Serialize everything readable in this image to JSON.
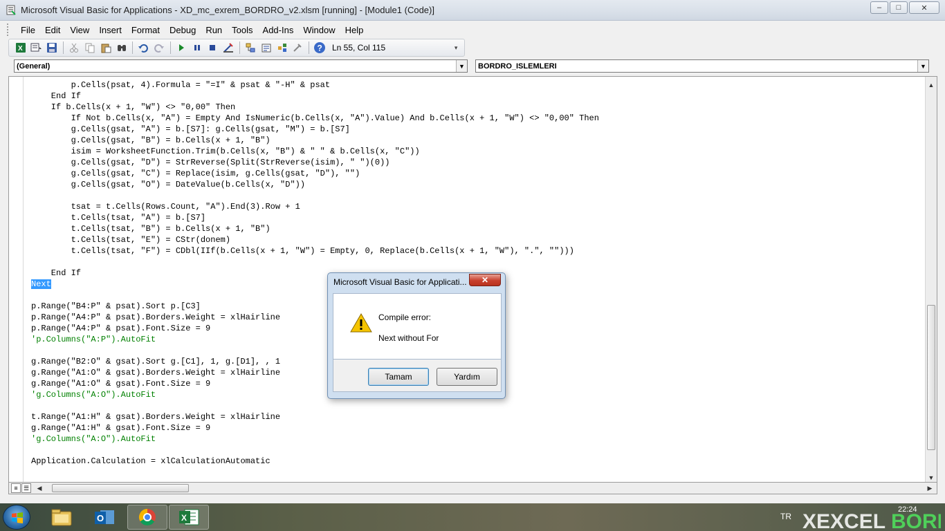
{
  "window": {
    "title": "Microsoft Visual Basic for Applications - XD_mc_exrem_BORDRO_v2.xlsm [running] - [Module1 (Code)]",
    "minimize_glyph": "–",
    "maximize_glyph": "□",
    "close_glyph": "✕"
  },
  "menu": {
    "items": [
      "File",
      "Edit",
      "View",
      "Insert",
      "Format",
      "Debug",
      "Run",
      "Tools",
      "Add-Ins",
      "Window",
      "Help"
    ]
  },
  "toolbar": {
    "icons": [
      "view-excel-icon",
      "insert-module-icon",
      "save-icon",
      "cut-icon",
      "copy-icon",
      "paste-icon",
      "find-icon",
      "undo-icon",
      "redo-icon",
      "run-icon",
      "break-icon",
      "reset-icon",
      "design-mode-icon",
      "project-explorer-icon",
      "properties-icon",
      "object-browser-icon",
      "toolbox-icon",
      "help-icon"
    ],
    "status": "Ln 55, Col 115"
  },
  "object_combo": {
    "value": "(General)"
  },
  "procedure_combo": {
    "value": "BORDRO_ISLEMLERI"
  },
  "code": {
    "lines": [
      {
        "text": "        p.Cells(psat, 4).Formula = \"=I\" & psat & \"-H\" & psat",
        "type": "code"
      },
      {
        "text": "    End If",
        "type": "code"
      },
      {
        "text": "    If b.Cells(x + 1, \"W\") <> \"0,00\" Then",
        "type": "code"
      },
      {
        "text": "        If Not b.Cells(x, \"A\") = Empty And IsNumeric(b.Cells(x, \"A\").Value) And b.Cells(x + 1, \"W\") <> \"0,00\" Then",
        "type": "code"
      },
      {
        "text": "        g.Cells(gsat, \"A\") = b.[S7]: g.Cells(gsat, \"M\") = b.[S7]",
        "type": "code"
      },
      {
        "text": "        g.Cells(gsat, \"B\") = b.Cells(x + 1, \"B\")",
        "type": "code"
      },
      {
        "text": "        isim = WorksheetFunction.Trim(b.Cells(x, \"B\") & \" \" & b.Cells(x, \"C\"))",
        "type": "code"
      },
      {
        "text": "        g.Cells(gsat, \"D\") = StrReverse(Split(StrReverse(isim), \" \")(0))",
        "type": "code"
      },
      {
        "text": "        g.Cells(gsat, \"C\") = Replace(isim, g.Cells(gsat, \"D\"), \"\")",
        "type": "code"
      },
      {
        "text": "        g.Cells(gsat, \"O\") = DateValue(b.Cells(x, \"D\"))",
        "type": "code"
      },
      {
        "text": "",
        "type": "code"
      },
      {
        "text": "        tsat = t.Cells(Rows.Count, \"A\").End(3).Row + 1",
        "type": "code"
      },
      {
        "text": "        t.Cells(tsat, \"A\") = b.[S7]",
        "type": "code"
      },
      {
        "text": "        t.Cells(tsat, \"B\") = b.Cells(x + 1, \"B\")",
        "type": "code"
      },
      {
        "text": "        t.Cells(tsat, \"E\") = CStr(donem)",
        "type": "code"
      },
      {
        "text": "        t.Cells(tsat, \"F\") = CDbl(IIf(b.Cells(x + 1, \"W\") = Empty, 0, Replace(b.Cells(x + 1, \"W\"), \".\", \"\")))",
        "type": "code"
      },
      {
        "text": "",
        "type": "code"
      },
      {
        "text": "    End If",
        "type": "code"
      },
      {
        "text": "Next",
        "type": "selected"
      },
      {
        "text": "",
        "type": "code"
      },
      {
        "text": "p.Range(\"B4:P\" & psat).Sort p.[C3]",
        "type": "code"
      },
      {
        "text": "p.Range(\"A4:P\" & psat).Borders.Weight = xlHairline",
        "type": "code"
      },
      {
        "text": "p.Range(\"A4:P\" & psat).Font.Size = 9",
        "type": "code"
      },
      {
        "text": "'p.Columns(\"A:P\").AutoFit",
        "type": "comment"
      },
      {
        "text": "",
        "type": "code"
      },
      {
        "text": "g.Range(\"B2:O\" & gsat).Sort g.[C1], 1, g.[D1], , 1",
        "type": "code"
      },
      {
        "text": "g.Range(\"A1:O\" & gsat).Borders.Weight = xlHairline",
        "type": "code"
      },
      {
        "text": "g.Range(\"A1:O\" & gsat).Font.Size = 9",
        "type": "code"
      },
      {
        "text": "'g.Columns(\"A:O\").AutoFit",
        "type": "comment"
      },
      {
        "text": "",
        "type": "code"
      },
      {
        "text": "t.Range(\"A1:H\" & gsat).Borders.Weight = xlHairline",
        "type": "code"
      },
      {
        "text": "g.Range(\"A1:H\" & gsat).Font.Size = 9",
        "type": "code"
      },
      {
        "text": "'g.Columns(\"A:O\").AutoFit",
        "type": "comment"
      },
      {
        "text": "",
        "type": "code"
      },
      {
        "text": "Application.Calculation = xlCalculationAutomatic",
        "type": "code"
      }
    ]
  },
  "dialog": {
    "title": "Microsoft Visual Basic for Applicati...",
    "close_glyph": "✕",
    "heading": "Compile error:",
    "message": "Next without For",
    "ok_label": "Tamam",
    "help_label": "Yardım",
    "icon": "warning-icon"
  },
  "taskbar": {
    "apps": [
      "windows-explorer-icon",
      "outlook-icon",
      "chrome-icon",
      "excel-icon"
    ],
    "lang": "TR",
    "clock": "22:24"
  }
}
